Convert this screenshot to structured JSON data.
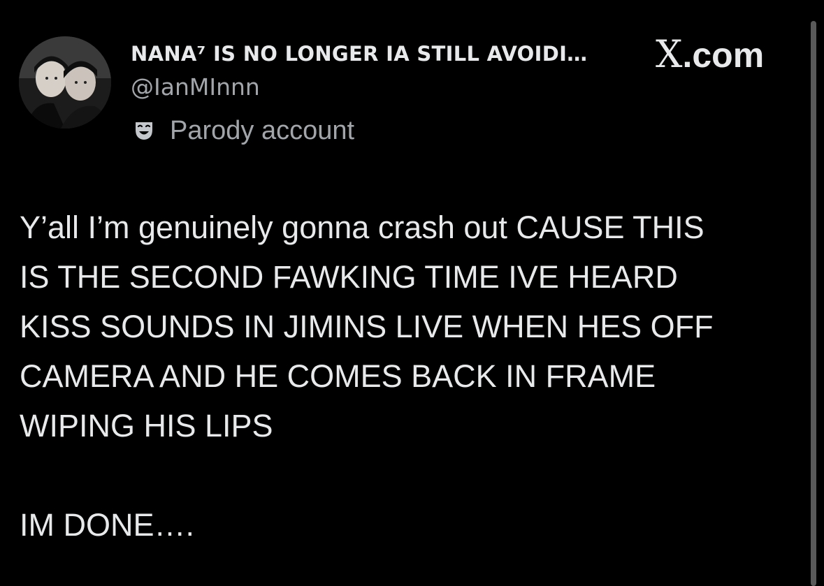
{
  "author": {
    "display_name": "NANA⁷ IS NO LONGER IA STILL AVOIDI…",
    "handle": "@IanMInnn",
    "parody_label": "Parody account",
    "parody_icon": "theater-masks-icon",
    "avatar": "profile-avatar-photo"
  },
  "brand": {
    "logo_x": "X",
    "logo_suffix": ".com"
  },
  "tweet": {
    "lines": [
      "Y’all I’m genuinely gonna crash out CAUSE THIS",
      "IS THE SECOND FAWKING TIME IVE HEARD",
      "KISS SOUNDS IN JIMINS LIVE WHEN HES OFF",
      "CAMERA AND HE COMES BACK IN FRAME",
      "WIPING HIS LIPS"
    ],
    "closing": "IM DONE…."
  },
  "colors": {
    "background": "#000000",
    "text_primary": "#e7e9ea",
    "text_secondary": "#a2a6aa",
    "scrollbar": "#5a5a5a"
  }
}
